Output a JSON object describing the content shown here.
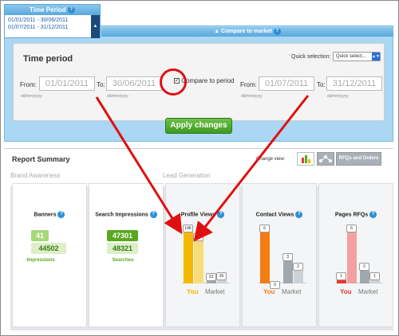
{
  "time_period": {
    "title": "Time Period",
    "line1": "01/01/2011 - 30/06/2011",
    "line2": "01/07/2011 - 31/12/2011",
    "collapse_icon": "▲"
  },
  "compare": {
    "header": "▲  Compare to market",
    "title": "Time period",
    "quick_label": "Quick selection:",
    "quick_value": "Quick select...",
    "from_label": "From:",
    "to_label": "To:",
    "from1": "01/01/2011",
    "to1": "30/06/2011",
    "from2": "01/07/2011",
    "to2": "31/12/2011",
    "hint": "dd/mm/yyyy",
    "checkbox_label": "Compare to period",
    "checkbox_checked": true,
    "apply": "Apply changes"
  },
  "report": {
    "title": "Report Summary",
    "change_view": "Change view:",
    "rfq_button": "RFQs and Orders",
    "brand_awareness": "Brand Awareness",
    "lead_generation": "Lead Generation",
    "banners": {
      "title": "Banners",
      "you": "41",
      "market": "44502",
      "caption": "Impressions"
    },
    "search": {
      "title": "Search Impressions",
      "you": "47301",
      "market": "48321",
      "caption": "Searches"
    },
    "profile_views": {
      "title": "Profile Views",
      "you_prev": "146",
      "you_curr": "123",
      "mkt_prev": "23",
      "mkt_curr": "26"
    },
    "contact_views": {
      "title": "Contact Views",
      "you_prev": "6",
      "you_curr": "0",
      "mkt_prev": "3",
      "mkt_curr": "2"
    },
    "pages_rfqs": {
      "title": "Pages RFQs",
      "you_prev": "1",
      "you_curr": "6",
      "mkt_prev": "2",
      "mkt_curr": "1"
    },
    "x_you": "You",
    "x_market": "Market",
    "colors": {
      "profile": "#f5b800",
      "contact": "#f57c12",
      "rfq": "#e83a2e",
      "market": "#9aa2aa",
      "green": "#5aa820"
    }
  },
  "help_icon": "?"
}
